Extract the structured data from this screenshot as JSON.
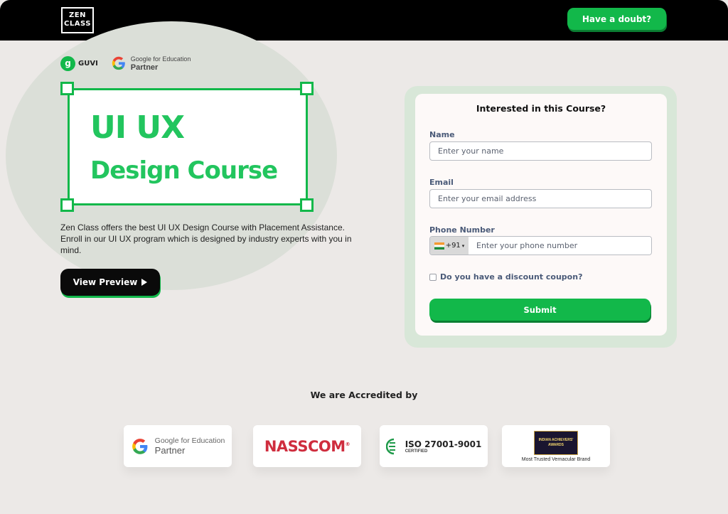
{
  "header": {
    "logo_line1": "ZEN",
    "logo_line2": "CLASS",
    "doubt_label": "Have a doubt?"
  },
  "partners": {
    "guvi_label": "GUVI",
    "google_line1": "Google for Education",
    "google_line2": "Partner"
  },
  "hero": {
    "title_line1": "UI UX",
    "title_line2": "Design Course",
    "description": "Zen Class offers the best UI UX Design Course with Placement Assistance. Enroll in our UI UX program which is designed by industry experts with you in mind.",
    "preview_label": "View Preview"
  },
  "form": {
    "title": "Interested in this Course?",
    "name_label": "Name",
    "name_placeholder": "Enter your name",
    "email_label": "Email",
    "email_placeholder": "Enter your email address",
    "phone_label": "Phone Number",
    "country_code": "+91",
    "phone_placeholder": "Enter your phone number",
    "coupon_label": "Do you have a discount coupon?",
    "submit_label": "Submit"
  },
  "accreditation": {
    "heading": "We are Accredited by",
    "google_line1": "Google for Education",
    "google_line2": "Partner",
    "nasscom": "NASSCOM",
    "nasscom_mark": "®",
    "iso_line1": "ISO 27001-9001",
    "iso_line2": "CERTIFIED",
    "award_caption": "Most Trusted Vernacular Brand",
    "award_badge_l1": "INDIAN ACHIEVERS'",
    "award_badge_l2": "AWARDS"
  },
  "colors": {
    "brand_green": "#12b84a",
    "hero_green": "#22c55e",
    "nasscom_red": "#cf2d3e",
    "background": "#ece9e7"
  }
}
